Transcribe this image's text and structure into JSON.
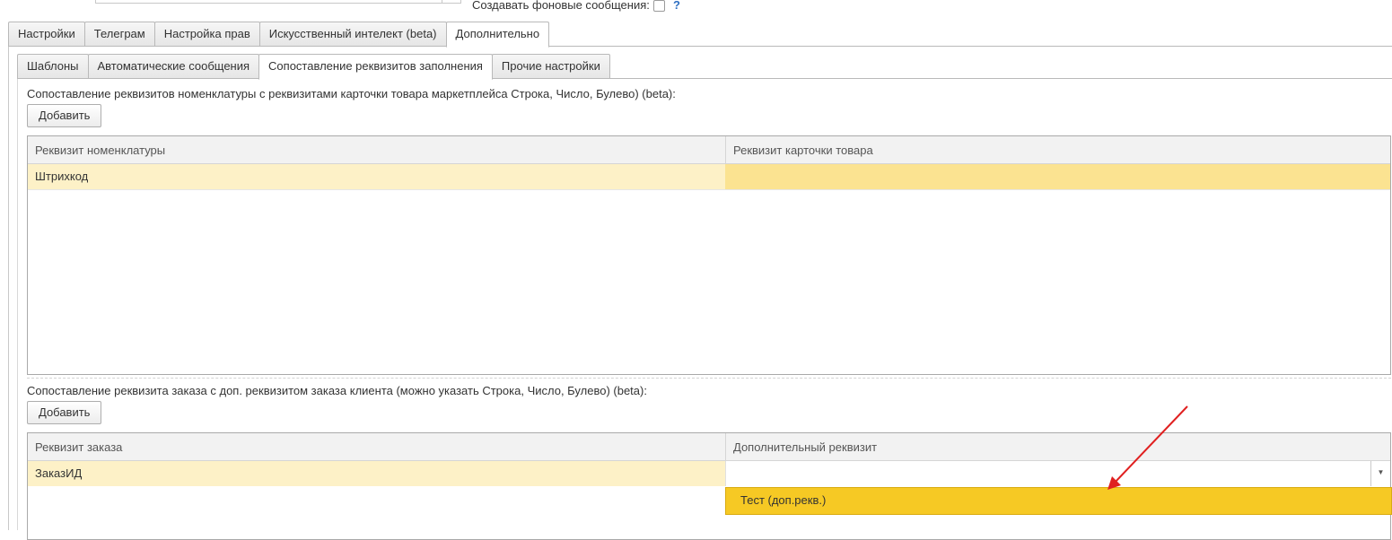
{
  "top": {
    "background_messages_label": "Создавать фоновые сообщения:",
    "background_messages_checked": false,
    "help_label": "?"
  },
  "main_tabs": [
    {
      "label": "Настройки",
      "active": false
    },
    {
      "label": "Телеграм",
      "active": false
    },
    {
      "label": "Настройка прав",
      "active": false
    },
    {
      "label": "Искусственный интелект (beta)",
      "active": false
    },
    {
      "label": "Дополнительно",
      "active": true
    }
  ],
  "sub_tabs": [
    {
      "label": "Шаблоны",
      "active": false
    },
    {
      "label": "Автоматические сообщения",
      "active": false
    },
    {
      "label": "Сопоставление реквизитов заполнения",
      "active": true
    },
    {
      "label": "Прочие настройки",
      "active": false
    }
  ],
  "section1": {
    "label": "Сопоставление реквизитов номенклатуры с реквизитами карточки товара маркетплейса Строка, Число, Булево) (beta):",
    "add_button": "Добавить",
    "columns": [
      "Реквизит номенклатуры",
      "Реквизит карточки товара"
    ],
    "rows": [
      {
        "col1": "Штрихкод",
        "col2": ""
      }
    ]
  },
  "section2": {
    "label": "Сопоставление реквизита заказа с доп. реквизитом заказа клиента (можно указать Строка, Число, Булево) (beta):",
    "add_button": "Добавить",
    "columns": [
      "Реквизит заказа",
      "Дополнительный реквизит"
    ],
    "rows": [
      {
        "col1": "ЗаказИД",
        "col2": ""
      }
    ],
    "dropdown_option": "Тест (доп.рекв.)"
  },
  "colors": {
    "selected_row": "#fdf1c7",
    "selected_cell": "#fbe391",
    "dropdown_highlight": "#f6c924",
    "annotation_arrow": "#e02020"
  }
}
